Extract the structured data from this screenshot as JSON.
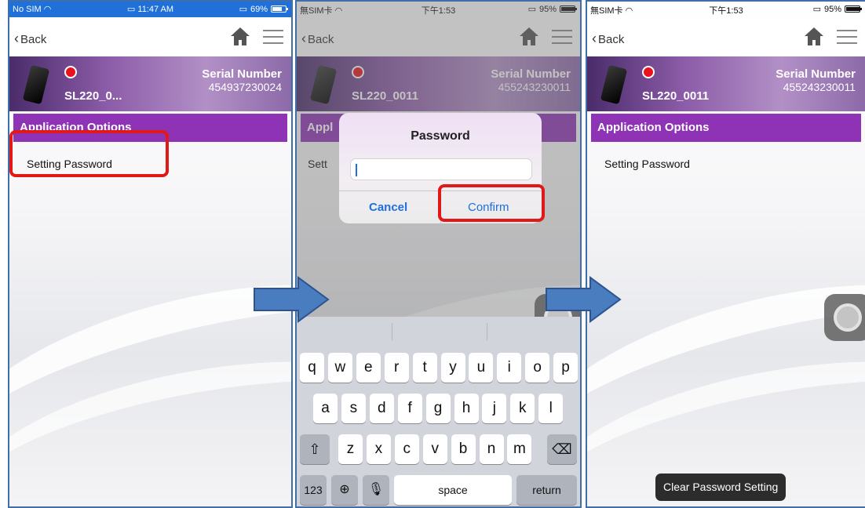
{
  "colors": {
    "accent_purple": "#8e32b6",
    "highlight_red": "#e01818",
    "ios_blue": "#1f6fe0",
    "status_red": "#e6141e",
    "arrow_blue": "#4a7cc0"
  },
  "screens": [
    {
      "statusbar": {
        "carrier": "No SIM",
        "wifi_icon": "wifi-icon",
        "time": "11:47 AM",
        "battery": "69%",
        "battery_level": 0.69
      },
      "nav": {
        "back_label": "Back"
      },
      "device": {
        "name": "SL220_0...",
        "serial_title": "Serial Number",
        "serial_value": "454937230024"
      },
      "options_header": "Application Options",
      "option_item": "Setting Password"
    },
    {
      "statusbar": {
        "carrier": "無SIM卡",
        "wifi_icon": "wifi-icon",
        "time": "下午1:53",
        "battery": "95%",
        "battery_level": 0.95
      },
      "nav": {
        "back_label": "Back"
      },
      "device": {
        "name": "SL220_0011",
        "serial_title": "Serial Number",
        "serial_value": "455243230011"
      },
      "options_header_partial": "Appl",
      "option_item_partial": "Sett",
      "dialog": {
        "title": "Password",
        "input_value": "",
        "cancel_label": "Cancel",
        "confirm_label": "Confirm"
      },
      "keyboard": {
        "row1": [
          "q",
          "w",
          "e",
          "r",
          "t",
          "y",
          "u",
          "i",
          "o",
          "p"
        ],
        "row2": [
          "a",
          "s",
          "d",
          "f",
          "g",
          "h",
          "j",
          "k",
          "l"
        ],
        "row3": [
          "z",
          "x",
          "c",
          "v",
          "b",
          "n",
          "m"
        ],
        "shift_icon": "shift-icon",
        "delete_icon": "delete-icon",
        "numbers_label": "123",
        "globe_icon": "globe-icon",
        "mic_icon": "microphone-icon",
        "space_label": "space",
        "return_label": "return"
      }
    },
    {
      "statusbar": {
        "carrier": "無SIM卡",
        "wifi_icon": "wifi-icon",
        "time": "下午1:53",
        "battery": "95%",
        "battery_level": 0.95
      },
      "nav": {
        "back_label": "Back"
      },
      "device": {
        "name": "SL220_0011",
        "serial_title": "Serial Number",
        "serial_value": "455243230011"
      },
      "options_header": "Application Options",
      "option_item": "Setting Password",
      "toast": "Clear Password Setting"
    }
  ]
}
